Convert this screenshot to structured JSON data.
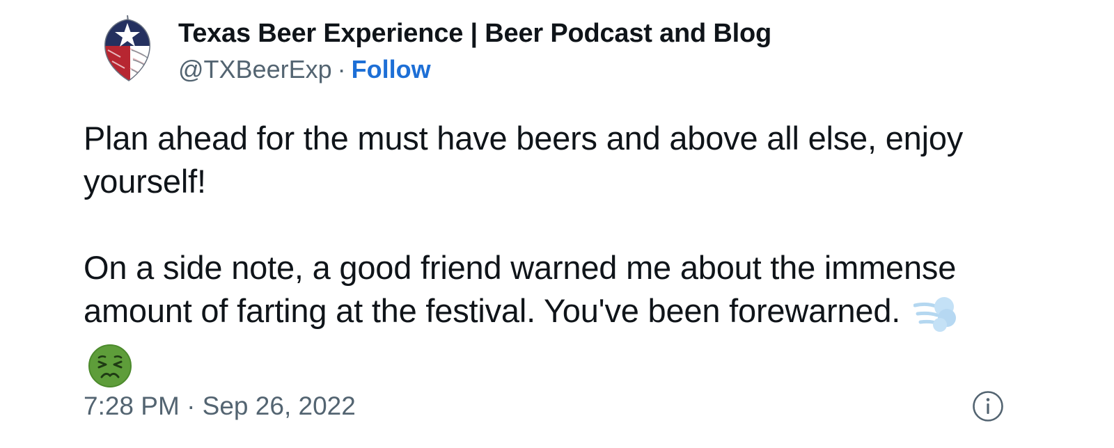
{
  "author": {
    "name": "Texas Beer Experience | Beer Podcast and Blog",
    "handle": "@TXBeerExp",
    "separator": "·",
    "follow_label": "Follow"
  },
  "tweet": {
    "paragraphs": [
      "Plan ahead for the must have beers and above all else, enjoy yourself!",
      "On a side note, a good friend warned me about the immense amount of farting at the festival. You've been forewarned."
    ],
    "emojis": [
      "dashing-away-icon",
      "nauseated-face-icon"
    ],
    "timestamp": "7:28 PM · Sep 26, 2022"
  },
  "icons": {
    "avatar": "texas-hop-logo",
    "info": "info-icon"
  },
  "colors": {
    "text": "#0f1419",
    "secondary": "#536471",
    "follow": "#1d6fd6"
  }
}
